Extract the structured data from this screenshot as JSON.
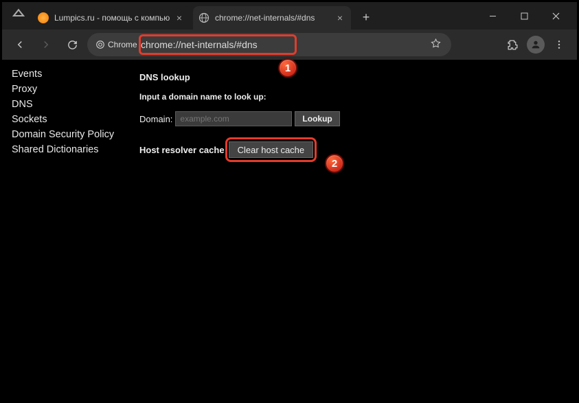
{
  "tabs": [
    {
      "title": "Lumpics.ru - помощь с компью",
      "favicon": "orange"
    },
    {
      "title": "chrome://net-internals/#dns",
      "favicon": "globe"
    }
  ],
  "active_tab_index": 1,
  "address_chip": "Chrome",
  "address_url": "chrome://net-internals/#dns",
  "sidebar": {
    "items": [
      "Events",
      "Proxy",
      "DNS",
      "Sockets",
      "Domain Security Policy",
      "Shared Dictionaries"
    ],
    "active_index": 2
  },
  "main": {
    "heading": "DNS lookup",
    "instruction": "Input a domain name to look up:",
    "domain_label": "Domain:",
    "domain_placeholder": "example.com",
    "lookup_button": "Lookup",
    "cache_label": "Host resolver cache",
    "clear_button": "Clear host cache"
  },
  "callouts": {
    "one": "1",
    "two": "2"
  }
}
